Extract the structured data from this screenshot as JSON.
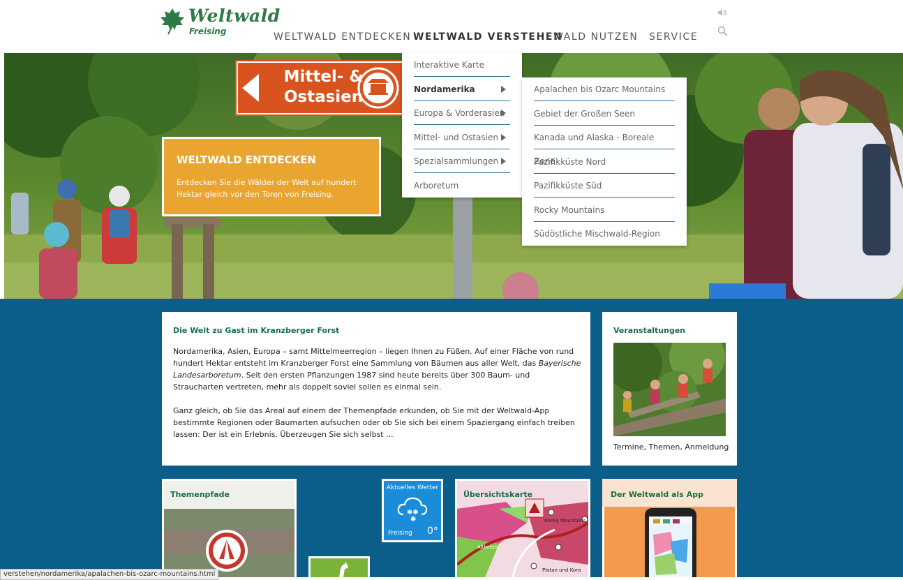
{
  "logo": {
    "name": "Weltwald",
    "sub": "Freising"
  },
  "nav": [
    {
      "label": "WELTWALD ENTDECKEN"
    },
    {
      "label": "WELTWALD VERSTEHEN"
    },
    {
      "label": "WALD NUTZEN"
    },
    {
      "label": "SERVICE"
    }
  ],
  "header_icons": {
    "speaker": "speaker-icon",
    "search": "search-icon"
  },
  "hero": {
    "sign_text_line1": "Mittel- &",
    "sign_text_line2": "Ostasien",
    "teaser_title": "WELTWALD ENTDECKEN",
    "teaser_text": "Entdecken Sie die Wälder der Welt auf hundert Hektar gleich vor den Toren von Freising."
  },
  "dropdown": {
    "level1": [
      {
        "label": "Interaktive Karte"
      },
      {
        "label": "Nordamerika"
      },
      {
        "label": "Europa & Vorderasien"
      },
      {
        "label": "Mittel- und Ostasien"
      },
      {
        "label": "Spezialsammlungen"
      },
      {
        "label": "Arboretum"
      }
    ],
    "level2": [
      {
        "label": "Apalachen bis Ozarc Mountains"
      },
      {
        "label": "Gebiet der Großen Seen"
      },
      {
        "label": "Kanada und Alaska - Boreale Zone"
      },
      {
        "label": "Pazifikküste Nord"
      },
      {
        "label": "Pazifikküste Süd"
      },
      {
        "label": "Rocky Mountains"
      },
      {
        "label": "Südöstliche Mischwald-Region"
      }
    ]
  },
  "intro": {
    "title": "Die Welt zu Gast im Kranzberger Forst",
    "p1_a": "Nordamerika, Asien, Europa – samt Mittelmeerregion – liegen Ihnen zu Füßen.  Auf einer Fläche von rund hundert Hektar entsteht im Kranzberger Forst eine Sammlung von Bäumen aus aller Welt, das ",
    "p1_em": "Bayerische Landesarboretum",
    "p1_b": ". Seit den ersten Pflanzungen 1987 sind heute bereits über 300 Baum- und Straucharten vertreten, mehr als doppelt soviel sollen es einmal sein.",
    "p2": "Ganz gleich, ob Sie das Areal auf einem der Themenpfade erkunden, ob Sie mit der Weltwald-App bestimmte Regionen oder Baumarten aufsuchen oder ob Sie sich bei einem Spaziergang einfach treiben lassen: Der ist ein Erlebnis. Überzeugen Sie sich selbst ..."
  },
  "events": {
    "title": "Veranstaltungen",
    "caption": "Termine, Themen, Anmeldung"
  },
  "tiles": {
    "themen": "Themenpfade",
    "weather_title": "Aktuelles Wetter",
    "weather_place": "Freising",
    "weather_temp": "0°",
    "karte": "Übersichtskarte",
    "karte_label1": "Rocky Mountains",
    "karte_label2": "Altkoten",
    "karte_label3": "Platan und Kora",
    "app": "Der Weltwald als App"
  },
  "statusbar": "verstehen/nordamerika/apalachen-bis-ozarc-mountains.html",
  "colors": {
    "green": "#2e7a45",
    "blue": "#0b5d8a",
    "orange": "#e9a52f",
    "sign": "#d9531e"
  }
}
